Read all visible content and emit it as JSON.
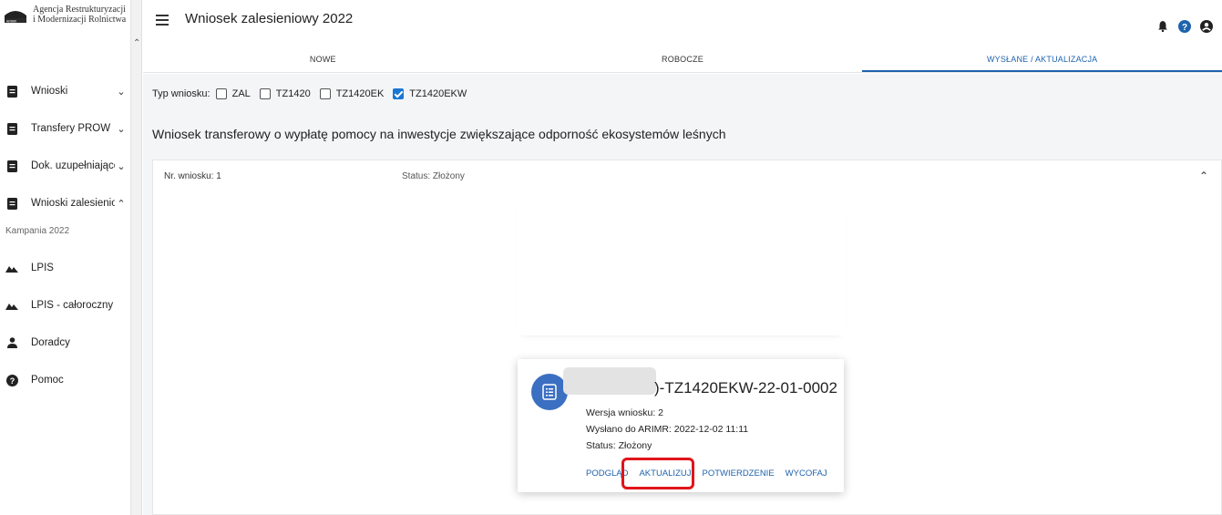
{
  "logo": {
    "line1": "Agencja Restrukturyzacji",
    "line2": "i Modernizacji Rolnictwa"
  },
  "sidebar": {
    "items": [
      {
        "label": "Wnioski",
        "icon": "document-icon",
        "chevron": "⌄"
      },
      {
        "label": "Transfery PROW",
        "icon": "document-icon",
        "chevron": "⌄"
      },
      {
        "label": "Dok. uzupełniające",
        "icon": "document-icon",
        "chevron": "⌄"
      },
      {
        "label": "Wnioski zalesieniowe",
        "icon": "document-icon",
        "chevron": "⌃"
      },
      {
        "label": "LPIS",
        "icon": "mountain-icon"
      },
      {
        "label": "LPIS - całoroczny",
        "icon": "mountain-icon"
      },
      {
        "label": "Doradcy",
        "icon": "person-icon"
      },
      {
        "label": "Pomoc",
        "icon": "help-icon"
      }
    ],
    "sub_label": "Kampania 2022"
  },
  "header": {
    "title": "Wniosek zalesieniowy 2022"
  },
  "tabs": [
    {
      "label": "NOWE"
    },
    {
      "label": "ROBOCZE"
    },
    {
      "label": "WYSŁANE / AKTUALIZACJA",
      "active": true
    }
  ],
  "filter": {
    "label": "Typ wniosku:",
    "options": [
      {
        "label": "ZAL",
        "checked": false
      },
      {
        "label": "TZ1420",
        "checked": false
      },
      {
        "label": "TZ1420EK",
        "checked": false
      },
      {
        "label": "TZ1420EKW",
        "checked": true
      }
    ]
  },
  "section": {
    "title": "Wniosek transferowy o wypłatę pomocy na inwestycje zwiększające odporność ekosystemów leśnych"
  },
  "panel": {
    "number": "Nr. wniosku: 1",
    "status": "Status: Złożony"
  },
  "card": {
    "id": ")-TZ1420EKW-22-01-0002",
    "version": "Wersja wniosku: 2",
    "sent": "Wysłano do ARIMR: 2022-12-02 11:11",
    "status": "Status: Złożony",
    "actions": {
      "preview": "PODGLĄD",
      "update": "AKTUALIZUJ",
      "confirm": "POTWIERDZENIE",
      "withdraw": "WYCOFAJ"
    }
  },
  "colors": {
    "accent": "#1e63ac",
    "highlight": "#e0141b",
    "card_icon": "#3b6fc2"
  }
}
